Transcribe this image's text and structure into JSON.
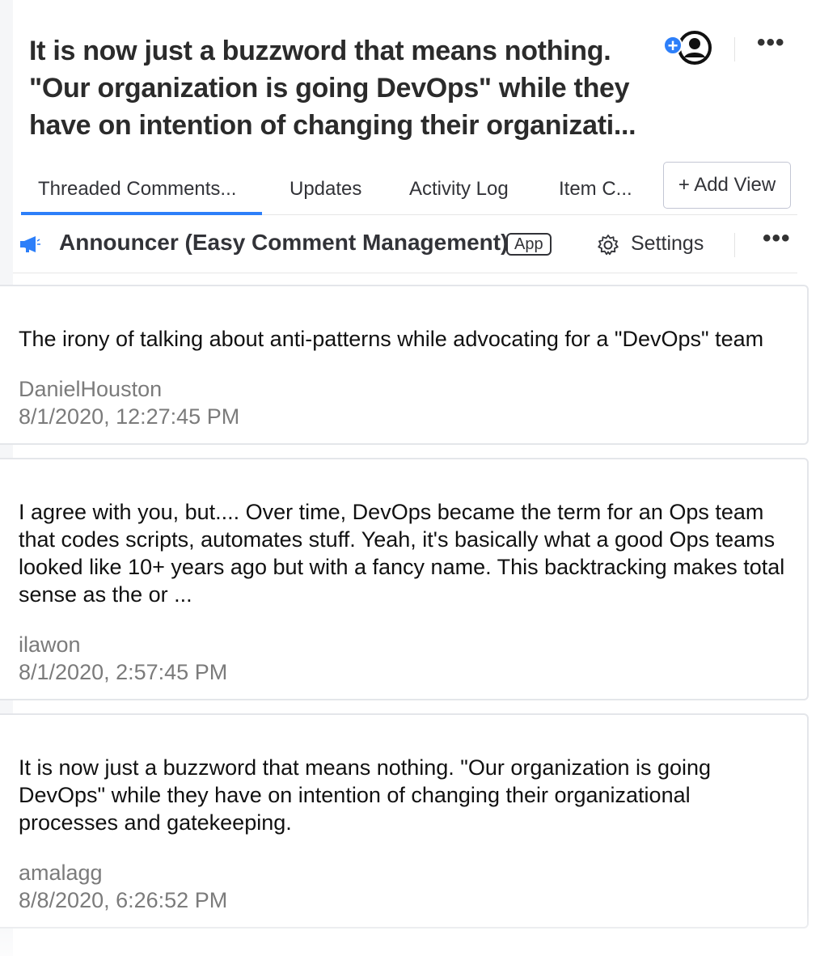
{
  "header": {
    "title": "It is now just a buzzword that means nothing. \"Our organization is going DevOps\" while they have on intention of changing their organizati...",
    "more_label": "•••"
  },
  "tabs": [
    {
      "label": "Threaded Comments..."
    },
    {
      "label": "Updates"
    },
    {
      "label": "Activity Log"
    },
    {
      "label": "Item C..."
    }
  ],
  "add_view_label": "+ Add View",
  "app_bar": {
    "name": "Announcer (Easy Comment Management)",
    "badge": "App",
    "settings_label": "Settings",
    "more_label": "•••"
  },
  "comments": [
    {
      "text": "The irony of talking about anti-patterns while advocating for a \"DevOps\" team",
      "author": "DanielHouston",
      "time": "8/1/2020, 12:27:45 PM"
    },
    {
      "text": "I agree with you, but.... Over time, DevOps became the term for an Ops team that codes scripts, automates stuff. Yeah, it's basically what a good Ops teams looked like 10+ years ago but with a fancy name. This backtracking makes total sense as the or ...",
      "author": "ilawon",
      "time": "8/1/2020, 2:57:45 PM"
    },
    {
      "text": "It is now just a buzzword that means nothing. \"Our organization is going DevOps\" while they have on intention of changing their organizational processes and gatekeeping.",
      "author": "amalagg",
      "time": "8/8/2020, 6:26:52 PM"
    }
  ],
  "colors": {
    "accent": "#2d7ff9",
    "text": "#323338",
    "muted": "#7b7b7b",
    "border": "#e4e6ea"
  }
}
